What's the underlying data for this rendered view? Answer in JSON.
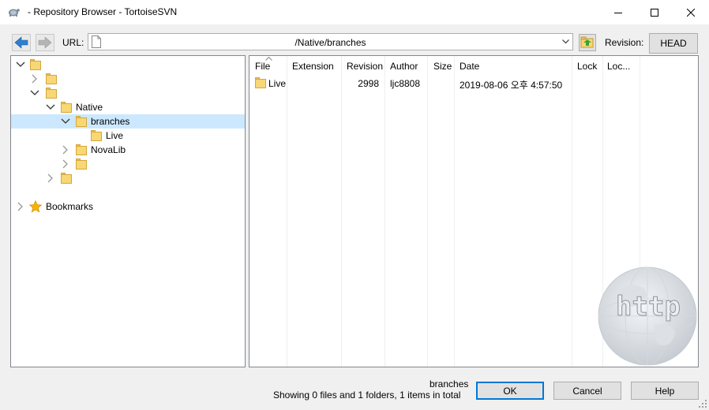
{
  "window": {
    "title": "- Repository Browser - TortoiseSVN",
    "controls": [
      "minimize",
      "maximize",
      "close"
    ]
  },
  "toolbar": {
    "url_label": "URL:",
    "url_value": "/Native/branches",
    "revision_label": "Revision:",
    "revision_button": "HEAD"
  },
  "tree": {
    "items": [
      {
        "label": "",
        "expanded": true,
        "level": 0
      },
      {
        "label": "",
        "expanded": false,
        "level": 1
      },
      {
        "label": "",
        "expanded": true,
        "level": 1
      },
      {
        "label": "Native",
        "expanded": true,
        "level": 2
      },
      {
        "label": "branches",
        "expanded": true,
        "level": 3,
        "selected": true
      },
      {
        "label": "Live",
        "level": 4
      },
      {
        "label": "NovaLib",
        "expanded": false,
        "level": 3
      },
      {
        "label": "",
        "expanded": false,
        "level": 3
      },
      {
        "label": "",
        "expanded": false,
        "level": 2
      }
    ],
    "bookmarks_label": "Bookmarks"
  },
  "list": {
    "columns": [
      "File",
      "Extension",
      "Revision",
      "Author",
      "Size",
      "Date",
      "Lock",
      "Loc..."
    ],
    "rows": [
      {
        "file": "Live",
        "extension": "",
        "revision": "2998",
        "author": "ljc8808",
        "size": "",
        "date": "2019-08-06 오후 4:57:50",
        "lock": "",
        "loc": ""
      }
    ]
  },
  "status": {
    "path": "branches",
    "summary": "Showing 0 files and 1 folders, 1 items in total"
  },
  "buttons": {
    "ok": "OK",
    "cancel": "Cancel",
    "help": "Help"
  },
  "watermark": {
    "text": "http"
  },
  "colors": {
    "selection": "#cce8ff",
    "folder": "#f8d775",
    "accent": "#0078d7"
  }
}
